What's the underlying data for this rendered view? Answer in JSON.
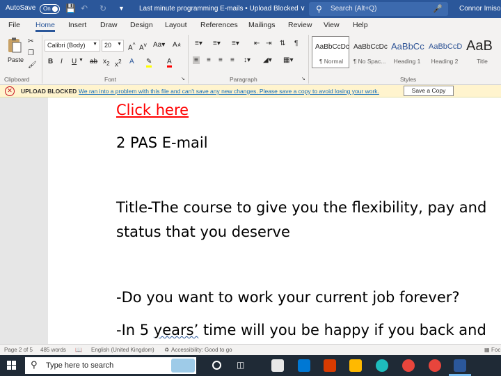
{
  "titlebar": {
    "autosave_label": "AutoSave",
    "autosave_state": "On",
    "doc_title": "Last minute programming E-mails • Upload Blocked ∨",
    "search_placeholder": "Search (Alt+Q)",
    "user_name": "Connor Imison",
    "color": "#2b579a"
  },
  "menu": {
    "tabs": [
      "File",
      "Home",
      "Insert",
      "Draw",
      "Design",
      "Layout",
      "References",
      "Mailings",
      "Review",
      "View",
      "Help"
    ],
    "active": "Home"
  },
  "ribbon": {
    "clipboard": {
      "paste_label": "Paste",
      "group_label": "Clipboard"
    },
    "font": {
      "font_name": "Calibri (Body)",
      "font_size": "20",
      "group_label": "Font"
    },
    "paragraph": {
      "group_label": "Paragraph"
    },
    "styles": {
      "group_label": "Styles",
      "items": [
        {
          "sample": "AaBbCcDc",
          "name": "¶ Normal"
        },
        {
          "sample": "AaBbCcDc",
          "name": "¶ No Spac..."
        },
        {
          "sample": "AaBbCc",
          "name": "Heading 1"
        },
        {
          "sample": "AaBbCcD",
          "name": "Heading 2"
        },
        {
          "sample": "AaB",
          "name": "Title"
        }
      ]
    }
  },
  "message_bar": {
    "label": "UPLOAD BLOCKED",
    "message": "We ran into a problem with this file and can't save any new changes. Please save a copy to avoid losing your work.",
    "button": "Save a Copy"
  },
  "document": {
    "link_text": "Click here",
    "heading": "2 PAS E-mail",
    "title_line_1": "Title-The course to give you the flexibility, pay and",
    "title_line_2": "status that you deserve",
    "bullet_1": "-Do you want to work your current job forever?",
    "bullet_2_prefix": "-In 5 ",
    "bullet_2_squiggle": "years’",
    "bullet_2_suffix": " time will you be happy if you back and"
  },
  "statusbar": {
    "page": "Page 2 of 5",
    "words": "485 words",
    "language": "English (United Kingdom)",
    "accessibility": "Accessibility: Good to go",
    "focus": "Foc"
  },
  "taskbar": {
    "search_placeholder": "Type here to search"
  }
}
